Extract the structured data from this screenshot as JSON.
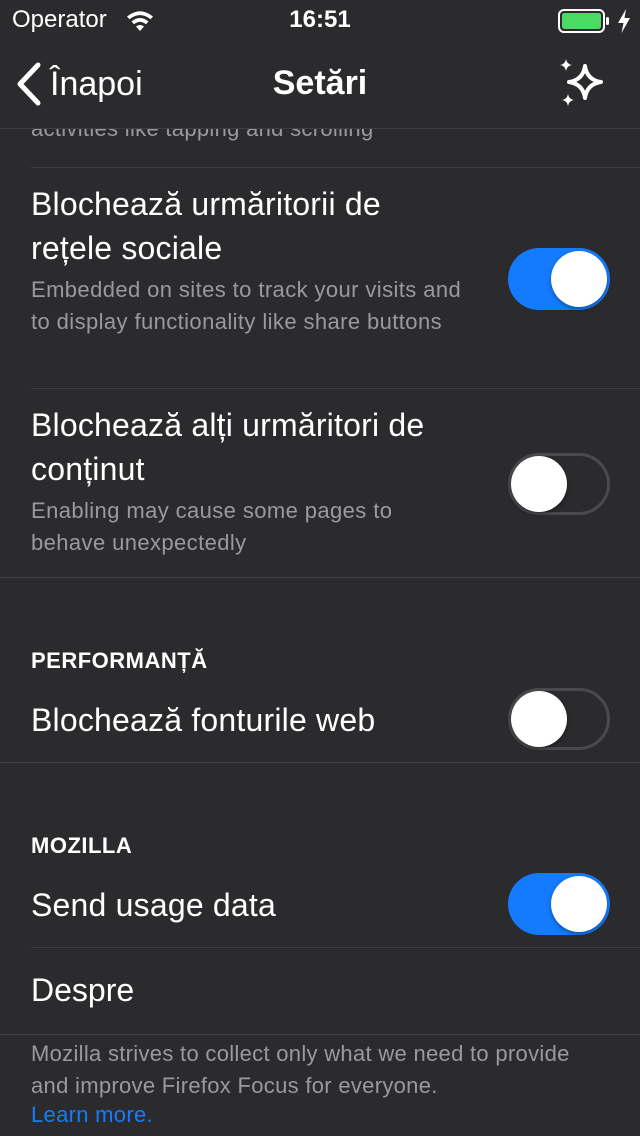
{
  "status_bar": {
    "carrier": "Operator",
    "time": "16:51",
    "battery_color": "#4cd964"
  },
  "nav": {
    "back_label": "Înapoi",
    "title": "Setări",
    "whats_new_icon": "sparkles-icon"
  },
  "settings": {
    "clipped_text": "activities like tapping and scrolling",
    "rows": [
      {
        "title": "Blochează urmăritorii de rețele sociale",
        "subtitle": "Embedded on sites to track your visits and to display functionality like share buttons",
        "enabled": true
      },
      {
        "title": "Blochează alți urmăritori de conținut",
        "subtitle": "Enabling may cause some pages to behave unexpectedly",
        "enabled": false
      }
    ],
    "performance": {
      "header": "PERFORMANȚĂ",
      "block_web_fonts_label": "Blochează fonturile web",
      "block_web_fonts_enabled": false
    },
    "mozilla": {
      "header": "MOZILLA",
      "send_usage_label": "Send usage data",
      "send_usage_enabled": true,
      "about_label": "Despre",
      "footer": "Mozilla strives to collect only what we need to provide and improve Firefox Focus for everyone.",
      "learn_more": "Learn more."
    }
  },
  "colors": {
    "background": "#2b2b2d",
    "accent": "#147bff",
    "secondary_text": "#9a9a9e",
    "separator": "#3f3f42"
  }
}
